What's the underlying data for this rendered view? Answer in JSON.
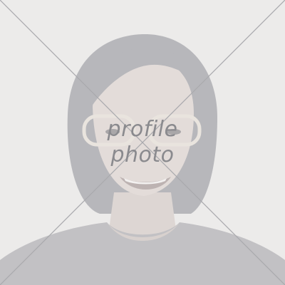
{
  "placeholder": {
    "line1": "profile",
    "line2": "photo"
  },
  "colors": {
    "background": "#ecebea",
    "hair": "#b7b7bb",
    "skin": "#e3dcd9",
    "shirt": "#c2c1c4",
    "cross_line": "#a9a9ad",
    "label": "#8a8a8e"
  },
  "icons": [
    "profile-photo-placeholder-icon"
  ]
}
